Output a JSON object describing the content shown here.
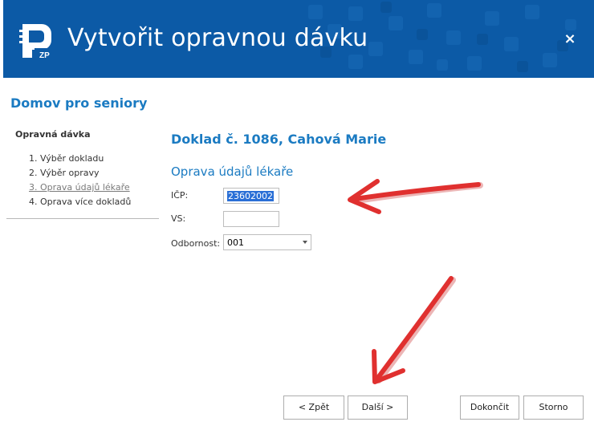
{
  "header": {
    "logo_text": "ZP",
    "title": "Vytvořit opravnou dávku",
    "close_label": "×"
  },
  "section_title": "Domov pro seniory",
  "steps": {
    "heading": "Opravná dávka",
    "items": [
      {
        "label": "1. Výběr dokladu"
      },
      {
        "label": "2. Výběr opravy"
      },
      {
        "label": "3. Oprava údajů lékaře"
      },
      {
        "label": "4. Oprava více dokladů"
      }
    ]
  },
  "content": {
    "doc_title": "Doklad č. 1086, Cahová Marie",
    "sub_title": "Oprava údajů lékaře",
    "fields": {
      "icp": {
        "label": "IČP:",
        "value": "23602002"
      },
      "vs": {
        "label": "VS:",
        "value": ""
      },
      "odbornost": {
        "label": "Odbornost:",
        "value": "001"
      }
    }
  },
  "buttons": {
    "back": "< Zpět",
    "next": "Další >",
    "finish": "Dokončit",
    "cancel": "Storno"
  },
  "colors": {
    "header_bg": "#0c5aa6",
    "accent": "#1b7bc2",
    "annotation_arrow": "#e0302f"
  }
}
